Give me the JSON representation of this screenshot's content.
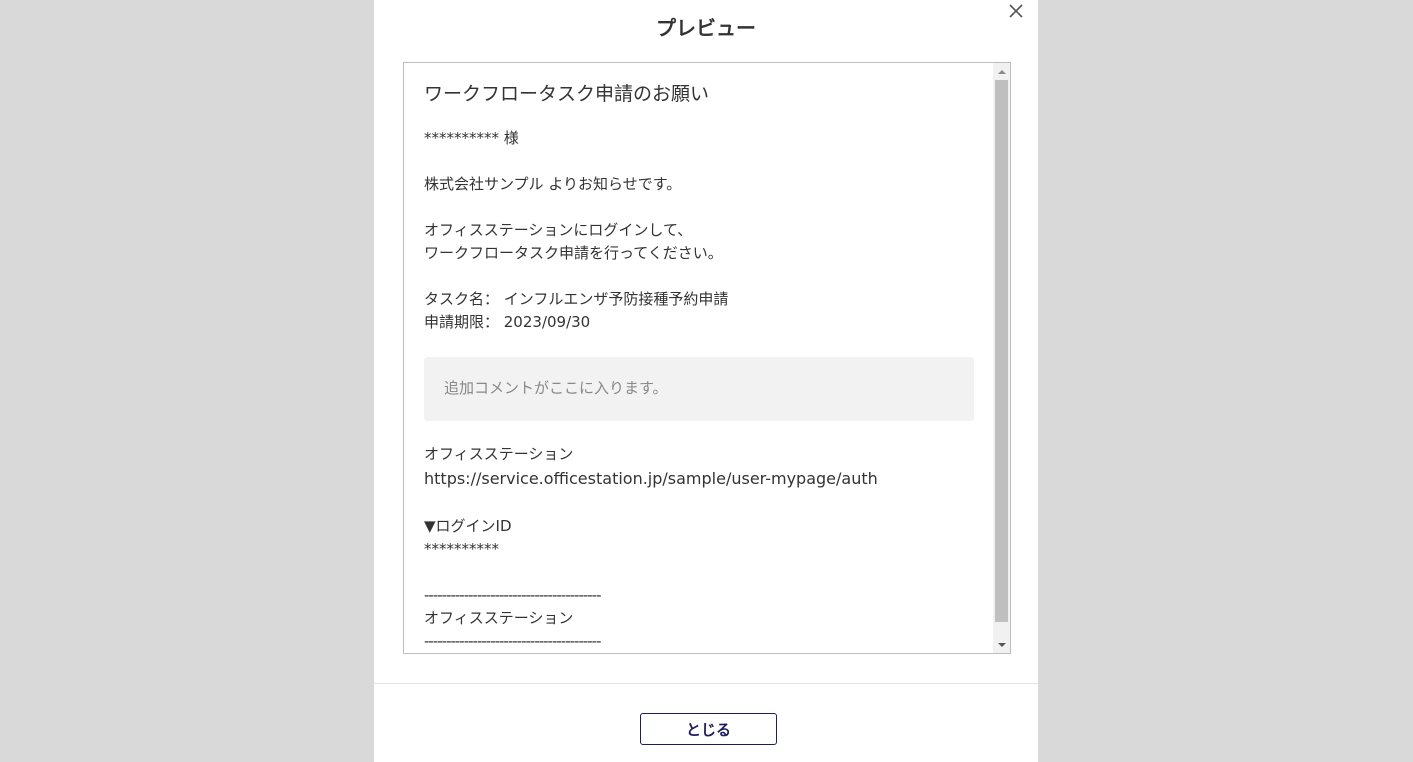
{
  "modal": {
    "title": "プレビュー",
    "close_footer_label": "とじる"
  },
  "mail": {
    "subject": "ワークフロータスク申請のお願い",
    "recipient": "********** 様",
    "intro": "株式会社サンプル よりお知らせです。",
    "instruction_line1": "オフィスステーションにログインして、",
    "instruction_line2": "ワークフロータスク申請を行ってください。",
    "task_name": "タスク名： インフルエンザ予防接種予約申請",
    "deadline": "申請期限： 2023/09/30",
    "comment": "追加コメントがここに入ります。",
    "service_name": "オフィスステーション",
    "url": "https://service.officestation.jp/sample/user-mypage/auth",
    "login_id_label": "▼ログインID",
    "login_id_value": "**********",
    "divider_top": "----------------------------------------",
    "signature": "オフィスステーション",
    "divider_bottom": "----------------------------------------"
  },
  "icons": {
    "close": "close-icon",
    "scroll_up": "triangle-up-icon",
    "scroll_down": "triangle-down-icon"
  },
  "colors": {
    "overlay": "#d9d9d9",
    "accent": "#1d1d5c",
    "comment_bg": "#f2f2f2"
  }
}
